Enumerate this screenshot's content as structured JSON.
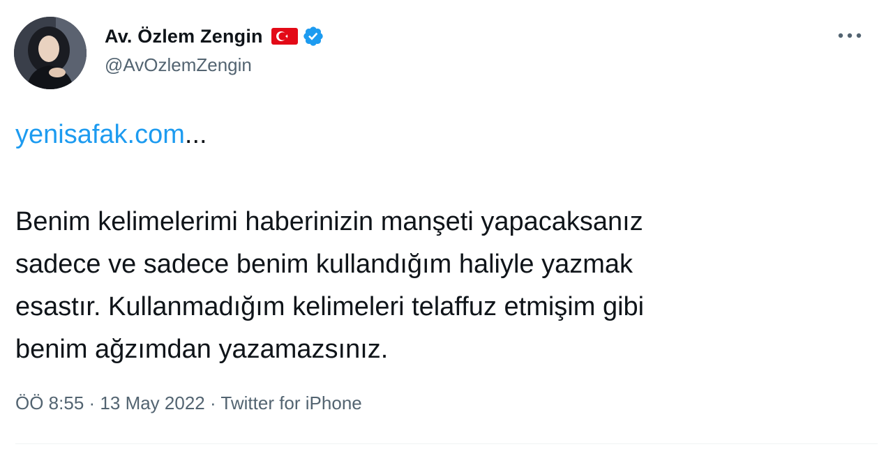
{
  "author": {
    "display_name": "Av. Özlem Zengin",
    "handle": "@AvOzlemZengin",
    "flag_icon": "turkey-flag-icon",
    "verified_icon": "verified-badge-icon"
  },
  "tweet": {
    "link_text": "yenisafak.com",
    "link_ellipsis": "...",
    "body_lines": [
      "Benim kelimelerimi haberinizin manşeti yapacaksanız",
      "sadece ve sadece benim kullandığım haliyle yazmak",
      "esastır. Kullanmadığım kelimeleri telaffuz etmişim gibi",
      "benim ağzımdan yazamazsınız."
    ]
  },
  "meta": {
    "time": "ÖÖ 8:55",
    "separator": "·",
    "date": "13 May 2022",
    "source": "Twitter for iPhone"
  },
  "actions": {
    "more_icon": "more-options-icon"
  },
  "colors": {
    "link": "#1d9bf0",
    "text": "#0f1419",
    "secondary": "#536471",
    "verified": "#1d9bf0",
    "flag_red": "#e30a17"
  }
}
